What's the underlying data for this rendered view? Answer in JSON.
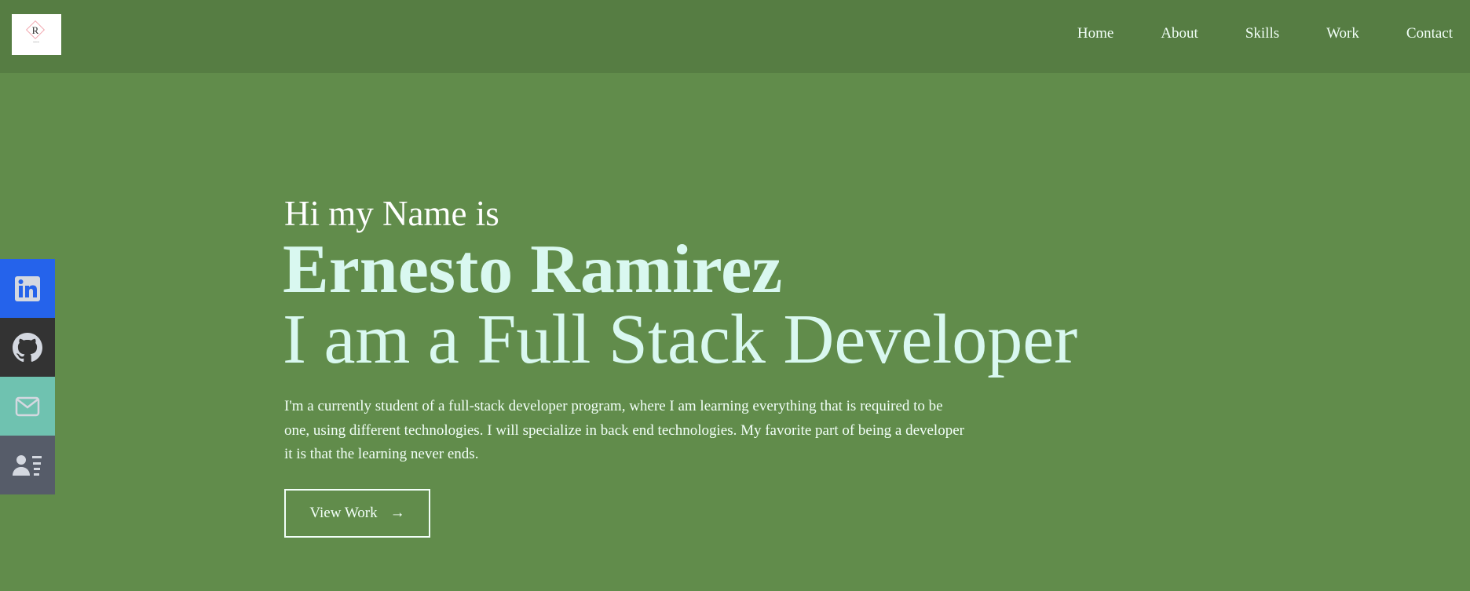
{
  "header": {
    "logo_alt": "R",
    "nav": [
      {
        "label": "Home"
      },
      {
        "label": "About"
      },
      {
        "label": "Skills"
      },
      {
        "label": "Work"
      },
      {
        "label": "Contact"
      }
    ]
  },
  "social": [
    {
      "icon": "linkedin-icon",
      "color": "#2563eb"
    },
    {
      "icon": "github-icon",
      "color": "#333333"
    },
    {
      "icon": "mail-icon",
      "color": "#6fc2b0"
    },
    {
      "icon": "resume-icon",
      "color": "#565c69"
    }
  ],
  "hero": {
    "greeting": "Hi my Name is",
    "name": "Ernesto Ramirez",
    "role": "I am a Full Stack Developer",
    "description": "I'm a currently student of a full-stack developer program, where I am learning everything that is required to be one, using different technologies. I will specialize in back end technologies. My favorite part of being a developer it is that the learning never ends.",
    "button_label": "View Work",
    "button_icon": "→"
  },
  "colors": {
    "header": "#567d43",
    "background": "#618c4b",
    "accent_text": "#d9f8f0"
  }
}
